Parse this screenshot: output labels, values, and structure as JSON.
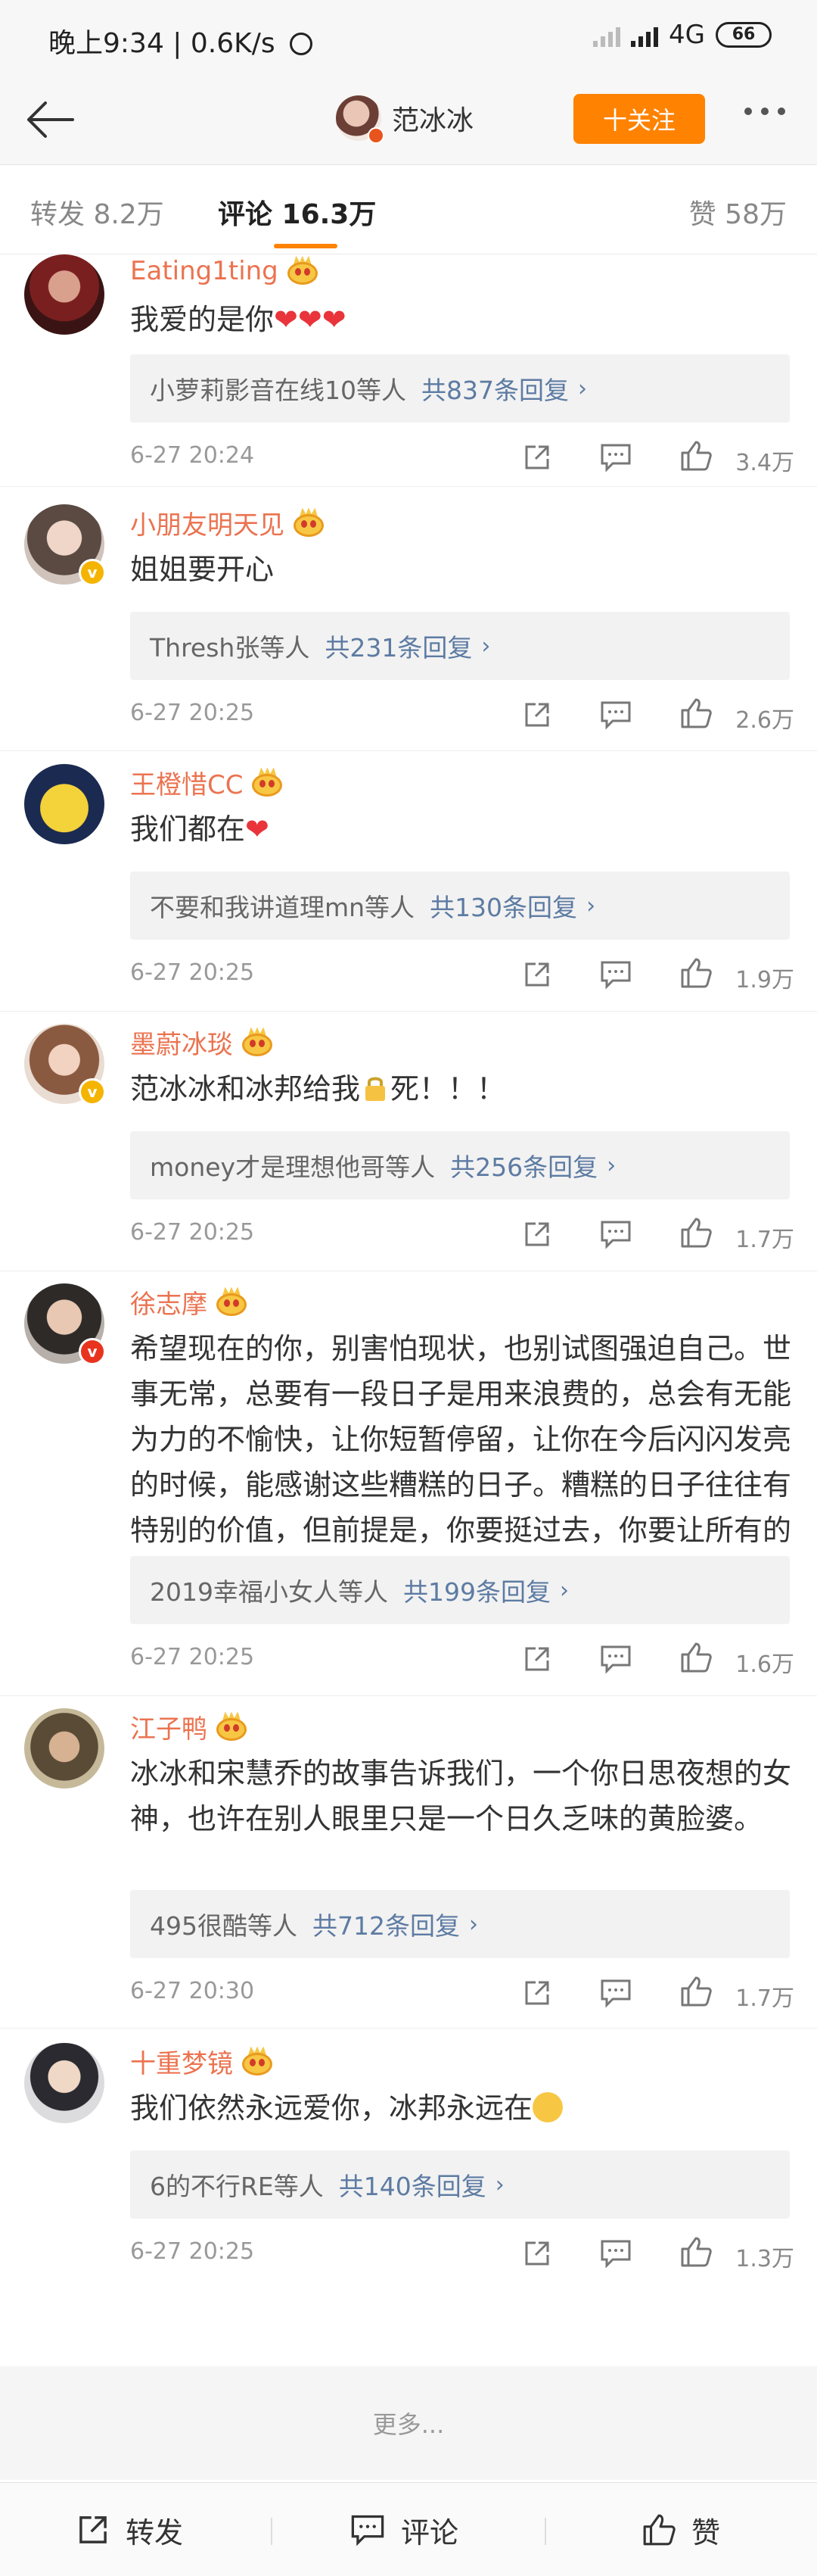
{
  "status_bar": {
    "time": "晚上9:34",
    "speed": "0.6K/s",
    "network": "4G",
    "battery": "66"
  },
  "nav": {
    "user_name": "范冰冰",
    "follow_label": "十关注"
  },
  "tabs": [
    {
      "label": "转发 8.2万"
    },
    {
      "label": "评论 16.3万"
    },
    {
      "label": "赞 58万"
    }
  ],
  "comments": [
    {
      "username": "Eating1ting",
      "text": "我爱的是你",
      "hearts": "❤❤❤",
      "reply_names": "小萝莉影音在线10等人",
      "reply_count": "共837条回复",
      "time": "6-27 20:24",
      "likes": "3.4万"
    },
    {
      "username": "小朋友明天见",
      "text": "姐姐要开心",
      "reply_names": "Thresh张等人",
      "reply_count": "共231条回复",
      "time": "6-27 20:25",
      "likes": "2.6万"
    },
    {
      "username": "王橙惜CC",
      "text": "我们都在",
      "hearts": "❤",
      "reply_names": "不要和我讲道理mn等人",
      "reply_count": "共130条回复",
      "time": "6-27 20:25",
      "likes": "1.9万"
    },
    {
      "username": "墨蔚冰琰",
      "text_before": "范冰冰和冰邦给我",
      "text_after": "死！！！",
      "reply_names": "money才是理想他哥等人",
      "reply_count": "共256条回复",
      "time": "6-27 20:25",
      "likes": "1.7万"
    },
    {
      "username": "徐志摩",
      "text": "希望现在的你，别害怕现状，也别试图强迫自己。世事无常，总要有一段日子是用来浪费的，总会有无能为力的不愉快，让你短暂停留，让你在今后闪闪发亮的时候，能感谢这些糟糕的日子。糟糕的日子往往有特别的价值，但前提是，你要挺过去，你要让所有的糟糕都变得值得。",
      "reply_names": "2019幸福小女人等人",
      "reply_count": "共199条回复",
      "time": "6-27 20:25",
      "likes": "1.6万"
    },
    {
      "username": "江子鸭",
      "text": "冰冰和宋慧乔的故事告诉我们，一个你日思夜想的女神，也许在别人眼里只是一个日久乏味的黄脸婆。",
      "reply_names": "495很酷等人",
      "reply_count": "共712条回复",
      "time": "6-27 20:30",
      "likes": "1.7万"
    },
    {
      "username": "十重梦镜",
      "text": "我们依然永远爱你，冰邦永远在",
      "reply_names": "6的不行RE等人",
      "reply_count": "共140条回复",
      "time": "6-27 20:25",
      "likes": "1.3万"
    }
  ],
  "more_label": "更多...",
  "bottom_bar": {
    "repost": "转发",
    "comment": "评论",
    "like": "赞"
  },
  "colors": {
    "accent": "#ff8200",
    "username": "#eb7350",
    "link": "#5d7ba3"
  }
}
